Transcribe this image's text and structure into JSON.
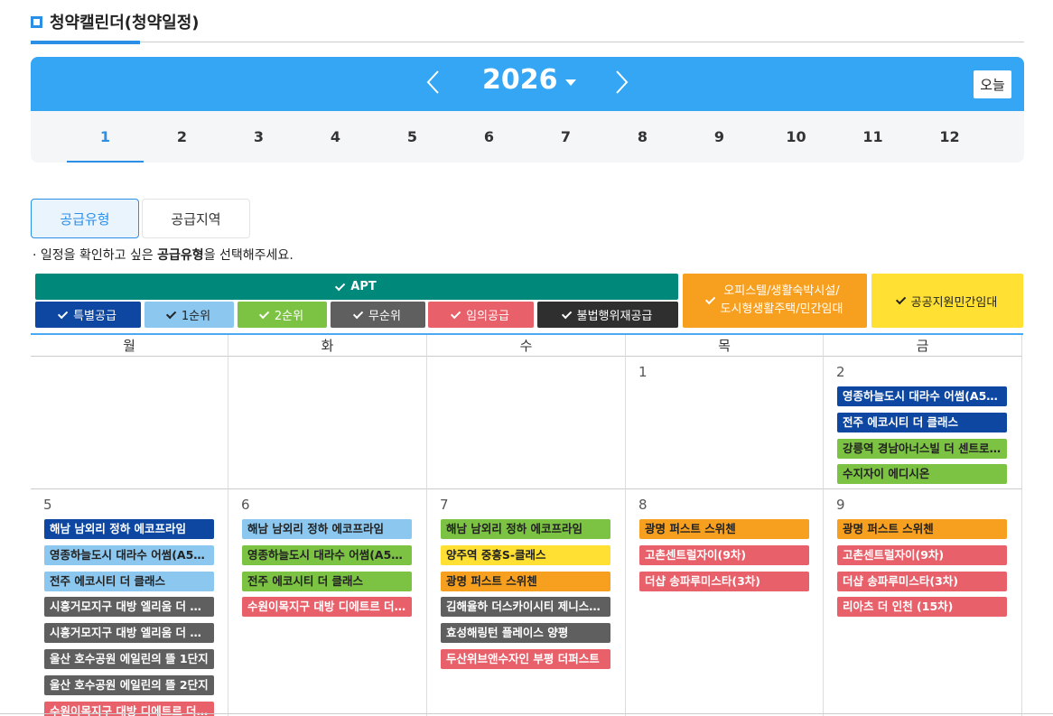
{
  "page": {
    "title": "청약캘린더(청약일정)"
  },
  "calendar": {
    "year": "2026",
    "today_label": "오늘"
  },
  "months": [
    "1",
    "2",
    "3",
    "4",
    "5",
    "6",
    "7",
    "8",
    "9",
    "10",
    "11",
    "12"
  ],
  "tabs": {
    "type": "공급유형",
    "region": "공급지역"
  },
  "guide": {
    "prefix": "· 일정을 확인하고 싶은 ",
    "bold": "공급유형",
    "suffix": "을 선택해주세요."
  },
  "legend": {
    "apt": "APT",
    "special": "특별공급",
    "first": "1순위",
    "second": "2순위",
    "none": "무순위",
    "random": "임의공급",
    "illegal": "불법행위재공급",
    "officetel_line1": "오피스텔/생활숙박시설/",
    "officetel_line2": "도시형생활주택/민간임대",
    "public": "공공지원민간임대"
  },
  "weekdays": [
    "월",
    "화",
    "수",
    "목",
    "금"
  ],
  "weeks": [
    {
      "days": [
        {
          "num": "",
          "events": []
        },
        {
          "num": "",
          "events": []
        },
        {
          "num": "",
          "events": []
        },
        {
          "num": "1",
          "events": []
        },
        {
          "num": "2",
          "events": [
            {
              "label": "영종하늘도시 대라수 어썸(A50…",
              "type": "special"
            },
            {
              "label": "전주 에코시티 더 클래스",
              "type": "special"
            },
            {
              "label": "강릉역 경남아너스빌 더 센트로(…",
              "type": "second"
            },
            {
              "label": "수지자이 에디시온",
              "type": "second"
            }
          ]
        }
      ]
    },
    {
      "days": [
        {
          "num": "5",
          "events": [
            {
              "label": "해남 남외리 정하 에코프라임",
              "type": "special"
            },
            {
              "label": "영종하늘도시 대라수 어썸(A50…",
              "type": "first"
            },
            {
              "label": "전주 에코시티 더 클래스",
              "type": "first"
            },
            {
              "label": "시흥거모지구 대방 엘리움 더 루…",
              "type": "none"
            },
            {
              "label": "시흥거모지구 대방 엘리움 더 루…",
              "type": "none"
            },
            {
              "label": "울산 호수공원 에일린의 뜰 1단지",
              "type": "none"
            },
            {
              "label": "울산 호수공원 에일린의 뜰 2단지",
              "type": "none"
            },
            {
              "label": "수원이목지구 대방 디에트르 더 …",
              "type": "random"
            }
          ]
        },
        {
          "num": "6",
          "events": [
            {
              "label": "해남 남외리 정하 에코프라임",
              "type": "first"
            },
            {
              "label": "영종하늘도시 대라수 어썸(A50…",
              "type": "second"
            },
            {
              "label": "전주 에코시티 더 클래스",
              "type": "second"
            },
            {
              "label": "수원이목지구 대방 디에트르 더 …",
              "type": "random"
            }
          ]
        },
        {
          "num": "7",
          "events": [
            {
              "label": "해남 남외리 정하 에코프라임",
              "type": "second"
            },
            {
              "label": "양주역 중흥S-클래스",
              "type": "public"
            },
            {
              "label": "광명 퍼스트 스위첸",
              "type": "officetel"
            },
            {
              "label": "김해율하 더스카이시티 제니스…",
              "type": "none"
            },
            {
              "label": "효성해링턴 플레이스 양평",
              "type": "none"
            },
            {
              "label": "두산위브앤수자인 부평 더퍼스트",
              "type": "random"
            }
          ]
        },
        {
          "num": "8",
          "events": [
            {
              "label": "광명 퍼스트 스위첸",
              "type": "officetel"
            },
            {
              "label": "고촌센트럴자이(9차)",
              "type": "random"
            },
            {
              "label": "더샵 송파루미스타(3차)",
              "type": "random"
            }
          ]
        },
        {
          "num": "9",
          "events": [
            {
              "label": "광명 퍼스트 스위첸",
              "type": "officetel"
            },
            {
              "label": "고촌센트럴자이(9차)",
              "type": "random"
            },
            {
              "label": "더샵 송파루미스타(3차)",
              "type": "random"
            },
            {
              "label": "리아츠 더 인천 (15차)",
              "type": "random"
            }
          ]
        }
      ]
    }
  ]
}
